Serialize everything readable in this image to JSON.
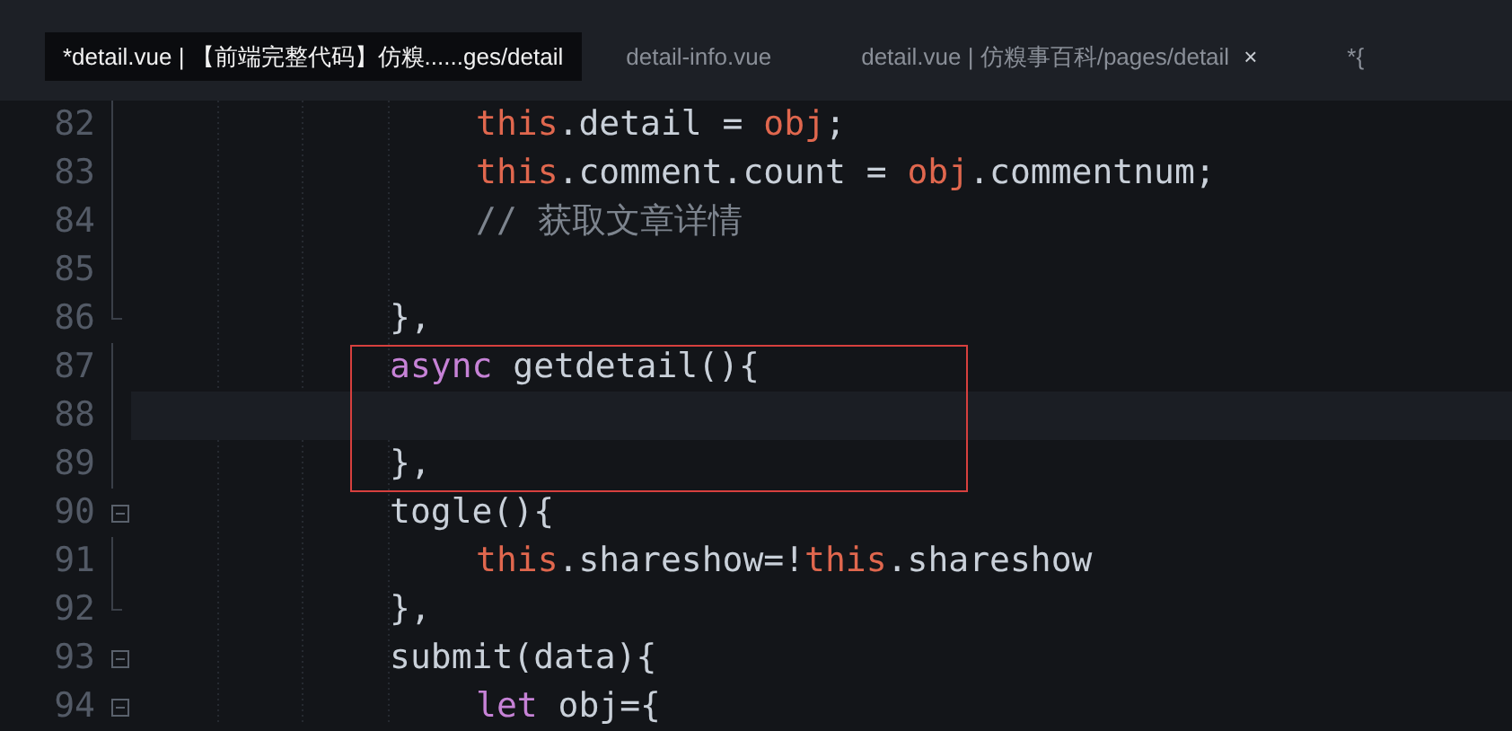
{
  "tabs": [
    {
      "label": "*detail.vue | 【前端完整代码】仿糗......ges/detail",
      "selected": true,
      "closable": false
    },
    {
      "label": "detail-info.vue",
      "selected": false,
      "closable": false
    },
    {
      "label": "detail.vue | 仿糗事百科/pages/detail",
      "selected": false,
      "closable": true,
      "close": "×"
    },
    {
      "label": "*{",
      "selected": false,
      "closable": false
    }
  ],
  "lines": [
    {
      "number": "82",
      "kind": "statement",
      "foldable": false,
      "fold_end": false,
      "current": false,
      "tokens": [
        {
          "kind": "this",
          "text": "this"
        },
        {
          "kind": "plain",
          "text": ".detail = "
        },
        {
          "kind": "object",
          "text": "obj"
        },
        {
          "kind": "plain",
          "text": ";"
        }
      ]
    },
    {
      "number": "83",
      "kind": "statement",
      "foldable": false,
      "fold_end": false,
      "current": false,
      "tokens": [
        {
          "kind": "this",
          "text": "this"
        },
        {
          "kind": "plain",
          "text": ".comment.count = "
        },
        {
          "kind": "object",
          "text": "obj"
        },
        {
          "kind": "plain",
          "text": ".commentnum;"
        }
      ]
    },
    {
      "number": "84",
      "kind": "statement",
      "foldable": false,
      "fold_end": false,
      "current": false,
      "tokens": [
        {
          "kind": "comment",
          "text": "// 获取文章详情"
        }
      ]
    },
    {
      "number": "85",
      "kind": "blank",
      "foldable": false,
      "fold_end": false,
      "current": false
    },
    {
      "number": "86",
      "kind": "member",
      "foldable": false,
      "fold_end": true,
      "current": false,
      "tokens": [
        {
          "kind": "plain",
          "text": "},"
        }
      ]
    },
    {
      "number": "87",
      "kind": "member",
      "foldable": false,
      "fold_end": false,
      "current": false,
      "tokens": [
        {
          "kind": "keyword",
          "text": "async"
        },
        {
          "kind": "plain",
          "text": " getdetail(){"
        }
      ]
    },
    {
      "number": "88",
      "kind": "blank",
      "foldable": false,
      "fold_end": false,
      "current": true
    },
    {
      "number": "89",
      "kind": "member",
      "foldable": false,
      "fold_end": false,
      "current": false,
      "tokens": [
        {
          "kind": "plain",
          "text": "},"
        }
      ]
    },
    {
      "number": "90",
      "kind": "member",
      "foldable": true,
      "fold_end": false,
      "current": false,
      "tokens": [
        {
          "kind": "plain",
          "text": "togle(){"
        }
      ]
    },
    {
      "number": "91",
      "kind": "statement",
      "foldable": false,
      "fold_end": false,
      "current": false,
      "tokens": [
        {
          "kind": "this",
          "text": "this"
        },
        {
          "kind": "plain",
          "text": ".shareshow=!"
        },
        {
          "kind": "this",
          "text": "this"
        },
        {
          "kind": "plain",
          "text": ".shareshow"
        }
      ]
    },
    {
      "number": "92",
      "kind": "member",
      "foldable": false,
      "fold_end": true,
      "current": false,
      "tokens": [
        {
          "kind": "plain",
          "text": "},"
        }
      ]
    },
    {
      "number": "93",
      "kind": "member",
      "foldable": true,
      "fold_end": false,
      "current": false,
      "tokens": [
        {
          "kind": "plain",
          "text": "submit(data){"
        }
      ]
    },
    {
      "number": "94",
      "kind": "statement",
      "foldable": true,
      "fold_end": false,
      "current": false,
      "tokens": [
        {
          "kind": "keyword",
          "text": "let"
        },
        {
          "kind": "plain",
          "text": " obj={"
        }
      ]
    }
  ]
}
